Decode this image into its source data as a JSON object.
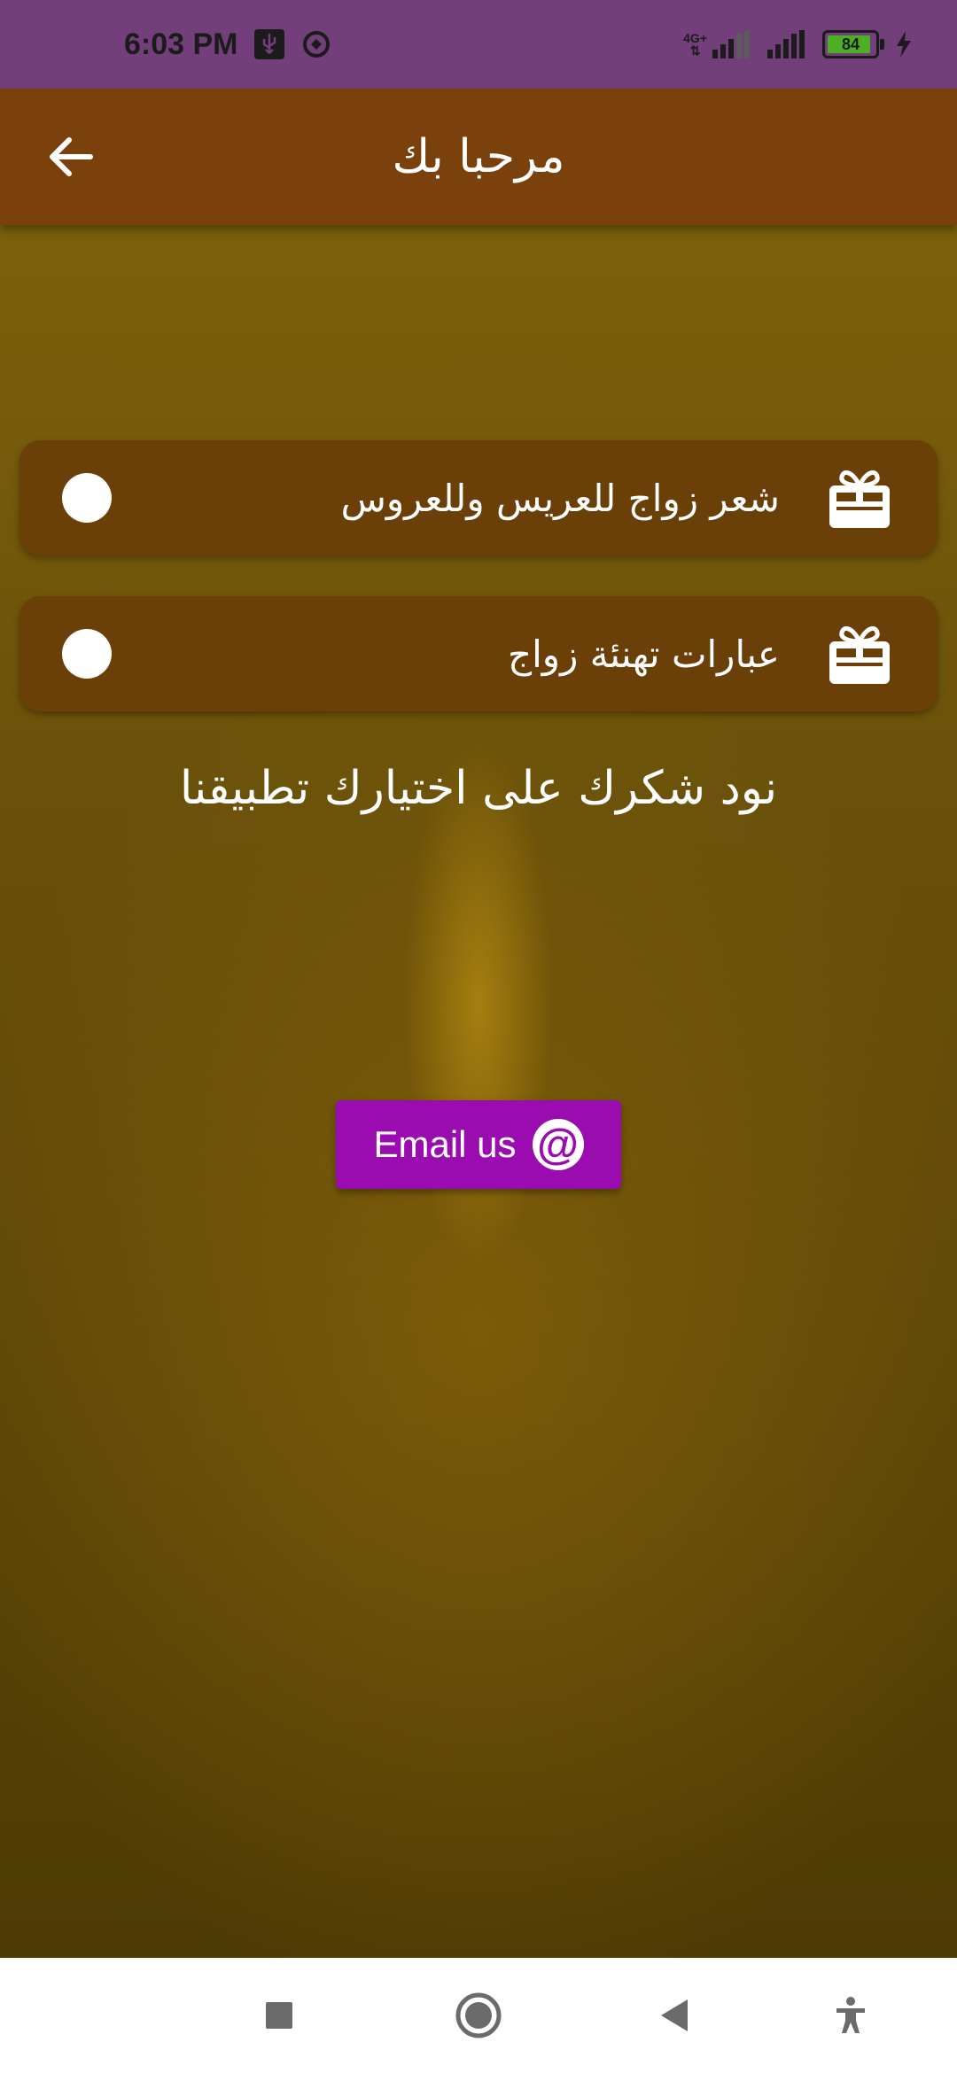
{
  "status_bar": {
    "time": "6:03 PM",
    "network_type": "4G+",
    "battery_level": "84",
    "icons": [
      "usb-icon",
      "sync-icon",
      "signal-icon",
      "battery-icon",
      "charging-icon"
    ]
  },
  "app_bar": {
    "title": "مرحبا بك",
    "back_icon": "arrow-left-icon",
    "color": "#7a410c"
  },
  "options": [
    {
      "label": "شعر زواج للعريس وللعروس",
      "icon": "gift-icon",
      "selected": false
    },
    {
      "label": "عبارات تهنئة زواج",
      "icon": "gift-icon",
      "selected": false
    }
  ],
  "thanks_text": "نود شكرك على اختيارك تطبيقنا",
  "email_button": {
    "label": "Email us",
    "icon": "at-icon",
    "color": "#9a0bb0"
  },
  "nav_bar": {
    "icons": [
      "square-icon",
      "home-circle-icon",
      "back-triangle-icon",
      "accessibility-icon"
    ]
  }
}
